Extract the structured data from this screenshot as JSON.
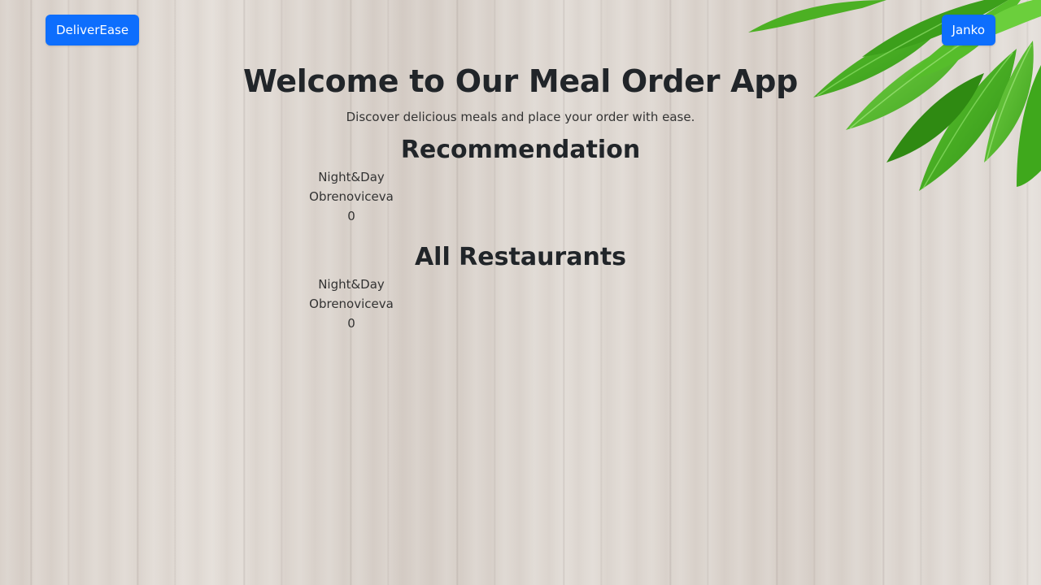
{
  "nav": {
    "brand_label": "DeliverEase",
    "user_label": "Janko"
  },
  "hero": {
    "title": "Welcome to Our Meal Order App",
    "subtitle": "Discover delicious meals and place your order with ease."
  },
  "recommendation": {
    "heading": "Recommendation",
    "items": [
      {
        "name": "Night&Day",
        "address": "Obrenoviceva",
        "rating": "0"
      }
    ]
  },
  "all_restaurants": {
    "heading": "All Restaurants",
    "items": [
      {
        "name": "Night&Day",
        "address": "Obrenoviceva",
        "rating": "0"
      }
    ]
  },
  "colors": {
    "accent": "#0d6efd",
    "text": "#212529",
    "background": "#ddd6cf",
    "leaf": "#3fa81c"
  },
  "decor": {
    "background_image": "light-wood-texture",
    "corner_image": "green-leaves"
  }
}
